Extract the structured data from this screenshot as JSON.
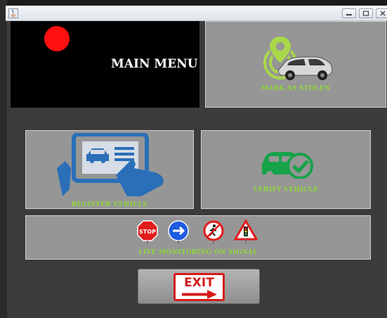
{
  "window": {
    "controls": [
      "minimize",
      "maximize",
      "close"
    ]
  },
  "main_menu": {
    "title": "MAIN MENU"
  },
  "mark_stolen": {
    "label": "MARK AS STOLEN"
  },
  "register": {
    "label": "REGISTER VEHICLE"
  },
  "verify": {
    "label": "VERIFY VEHICLE"
  },
  "live_monitoring": {
    "label": "LIVE MONITORING ON SIGNAL",
    "signs": [
      "stop-sign",
      "direction-arrow-sign",
      "pedestrian-sign",
      "warning-signal-sign"
    ],
    "stop_text": "STOP"
  },
  "exit": {
    "label": "EXIT"
  },
  "colors": {
    "background": "#3b3b3b",
    "panel": "#969696",
    "caption_green": "#8ed63a",
    "red": "#ff1010"
  }
}
